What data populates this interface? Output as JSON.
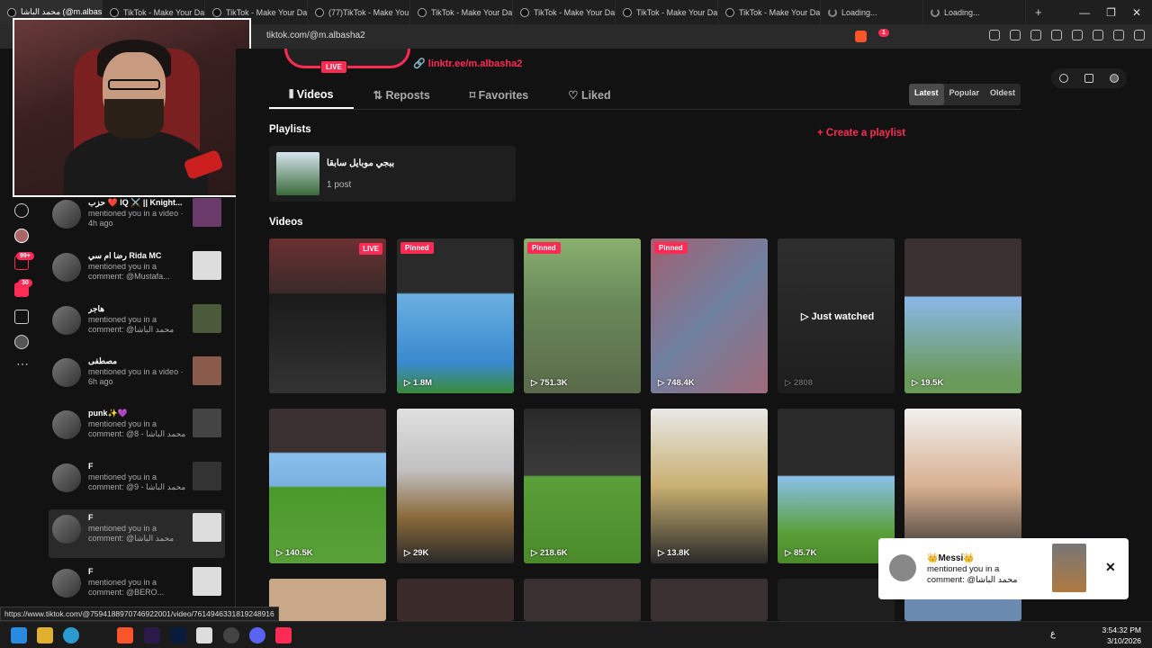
{
  "browser": {
    "tabs": [
      {
        "title": "محمد الباشا (@m.albasha2)",
        "active": true,
        "loading": false
      },
      {
        "title": "TikTok - Make Your Da",
        "active": false,
        "loading": false
      },
      {
        "title": "TikTok - Make Your Da",
        "active": false,
        "loading": false
      },
      {
        "title": "(77)TikTok - Make You",
        "active": false,
        "loading": false
      },
      {
        "title": "TikTok - Make Your Da",
        "active": false,
        "loading": false
      },
      {
        "title": "TikTok - Make Your Da",
        "active": false,
        "loading": false
      },
      {
        "title": "TikTok - Make Your Da",
        "active": false,
        "loading": false
      },
      {
        "title": "TikTok - Make Your Da",
        "active": false,
        "loading": false
      },
      {
        "title": "Loading...",
        "active": false,
        "loading": true
      },
      {
        "title": "Loading...",
        "active": false,
        "loading": true
      }
    ],
    "new_tab": "+",
    "url": "tiktok.com/@m.albasha2",
    "shield_count": "1",
    "status_url": "https://www.tiktok.com/@7594188970746922001/video/7614946331819248916"
  },
  "sidebar": {
    "badges": {
      "inbox": "99+",
      "messages": "30"
    }
  },
  "notifications": [
    {
      "name": "حزب ❤️ IQ ⚔️ || Knight...",
      "text": "mentioned you in a video · 4h ago"
    },
    {
      "name": "رضا ام سي Rida MC",
      "text": "mentioned you in a comment: @Mustafa..."
    },
    {
      "name": "هاجر",
      "text": "mentioned you in a comment: @محمد الباشا"
    },
    {
      "name": "مصطفى",
      "text": "mentioned you in a video · 6h ago"
    },
    {
      "name": "punk✨💜",
      "text": "mentioned you in a comment: @8 - محمد الباشا"
    },
    {
      "name": "F",
      "text": "mentioned you in a comment: @9 - محمد الباشا"
    },
    {
      "name": "F",
      "text": "mentioned you in a comment: @محمد الباشا"
    },
    {
      "name": "F",
      "text": "mentioned you in a comment: @BERO..."
    }
  ],
  "profile": {
    "live_label": "LIVE",
    "link": "linktr.ee/m.albasha2"
  },
  "profile_tabs": [
    "Videos",
    "Reposts",
    "Favorites",
    "Liked"
  ],
  "sort_options": [
    "Latest",
    "Popular",
    "Oldest"
  ],
  "playlists": {
    "heading": "Playlists",
    "create_label": "Create a playlist",
    "items": [
      {
        "title": "ببجي موبايل سابقا",
        "count": "1 post"
      }
    ]
  },
  "videos": {
    "heading": "Videos",
    "items": [
      {
        "tag": "LIVE",
        "views": "",
        "label": ""
      },
      {
        "tag": "Pinned",
        "views": "1.8M",
        "label": ""
      },
      {
        "tag": "Pinned",
        "views": "751.3K",
        "label": ""
      },
      {
        "tag": "Pinned",
        "views": "748.4K",
        "label": ""
      },
      {
        "tag": "",
        "views": "2808",
        "label": "Just watched"
      },
      {
        "tag": "",
        "views": "19.5K",
        "label": ""
      },
      {
        "tag": "",
        "views": "140.5K",
        "label": ""
      },
      {
        "tag": "",
        "views": "29K",
        "label": ""
      },
      {
        "tag": "",
        "views": "218.6K",
        "label": ""
      },
      {
        "tag": "",
        "views": "13.8K",
        "label": ""
      },
      {
        "tag": "",
        "views": "85.7K",
        "label": ""
      },
      {
        "tag": "",
        "views": "",
        "label": ""
      }
    ]
  },
  "toast": {
    "name": "👑Messi👑",
    "text": "mentioned you in a comment: @محمد الباشا",
    "close": "✕"
  },
  "taskbar": {
    "lang": "ع",
    "time": "3:54:32 PM",
    "date": "3/10/2026"
  },
  "colors": {
    "accent": "#fe2c55",
    "background": "#121212"
  }
}
